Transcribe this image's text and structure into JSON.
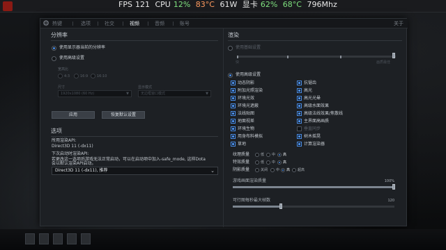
{
  "overlay": {
    "fps_label": "FPS",
    "fps_value": "121",
    "cpu_label": "CPU",
    "cpu_usage": "12%",
    "cpu_temp": "83°C",
    "power": "61W",
    "gpu_label": "显卡",
    "gpu_usage": "62%",
    "gpu_temp": "68°C",
    "gpu_clock": "796Mhz"
  },
  "tabs": [
    {
      "label": "热键"
    },
    {
      "label": "选项"
    },
    {
      "label": "社交"
    },
    {
      "label": "视频"
    },
    {
      "label": "音频"
    },
    {
      "label": "账号"
    }
  ],
  "active_tab": "视频",
  "close_label": "关于",
  "resolution": {
    "title": "分辨率",
    "use_desktop": "使用显示器当前的分辨率",
    "use_advanced": "使用高级设置",
    "aspect_label": "宽高比",
    "aspect_options": [
      "4:3",
      "16:9",
      "16:10"
    ],
    "size_label": "尺寸",
    "size_value": "1920x1080 (60 Hz)",
    "display_mode_label": "显示模式",
    "display_mode_value": "无边框窗口模式",
    "apply_button": "应用",
    "restore_button": "恢复默认设置"
  },
  "options": {
    "title": "选项",
    "api_label": "所用渲染API:",
    "api_value": "Direct3D 11 (-dx11)",
    "next_launch_label": "下次启动时渲染API:",
    "note_line1": "若更改这一选项后游戏无法正常启动，可以在启动项中加入-safe_mode, 这样Dota",
    "note_line2": "会以默认渲染API启动。",
    "dropdown_value": "Direct3D 11 (-dx11), 推荐"
  },
  "render": {
    "title": "渲染",
    "use_basic": "使用基础设置",
    "slider_left": "快",
    "slider_right": "画质最佳",
    "use_advanced": "使用高级设置",
    "checkboxes_left": [
      {
        "label": "动态阴影",
        "checked": true
      },
      {
        "label": "附加光照渲染",
        "checked": true
      },
      {
        "label": "环境光效",
        "checked": true
      },
      {
        "label": "环境光遮蔽",
        "checked": true
      },
      {
        "label": "法线贴图",
        "checked": true
      },
      {
        "label": "地面视差",
        "checked": true
      },
      {
        "label": "环境生物",
        "checked": true
      },
      {
        "label": "用身布料模拟",
        "checked": true
      },
      {
        "label": "草地",
        "checked": true
      }
    ],
    "checkboxes_right": [
      {
        "label": "抗锯齿",
        "checked": true
      },
      {
        "label": "高光",
        "checked": true
      },
      {
        "label": "高光光晕",
        "checked": true
      },
      {
        "label": "高级水面效果",
        "checked": true
      },
      {
        "label": "高级法线效果/焦散线",
        "checked": true
      },
      {
        "label": "主界面高画质",
        "checked": true
      },
      {
        "label": "垂直同步",
        "checked": false
      },
      {
        "label": "树木摇晃",
        "checked": true
      },
      {
        "label": "计算渲染器",
        "checked": true
      }
    ],
    "texture_quality_label": "纹理质量",
    "effects_quality_label": "特效质量",
    "shadow_quality_label": "阴影质量",
    "q_low": "低",
    "q_mid": "中",
    "q_high": "高",
    "q_off": "关闭",
    "q_ultra": "超高",
    "texture_selected": "高",
    "effects_selected": "高",
    "shadow_selected": "高",
    "render_quality_label": "游戏画面渲染质量",
    "render_quality_value": "100%",
    "render_quality_fraction": 1.0,
    "max_fps_label": "可行图每秒最大帧数",
    "max_fps_value": "120",
    "max_fps_fraction": 0.3
  },
  "colors": {
    "accent": "#4a8ee8",
    "hot": "#ff9a5e",
    "ok": "#7ee07e"
  }
}
